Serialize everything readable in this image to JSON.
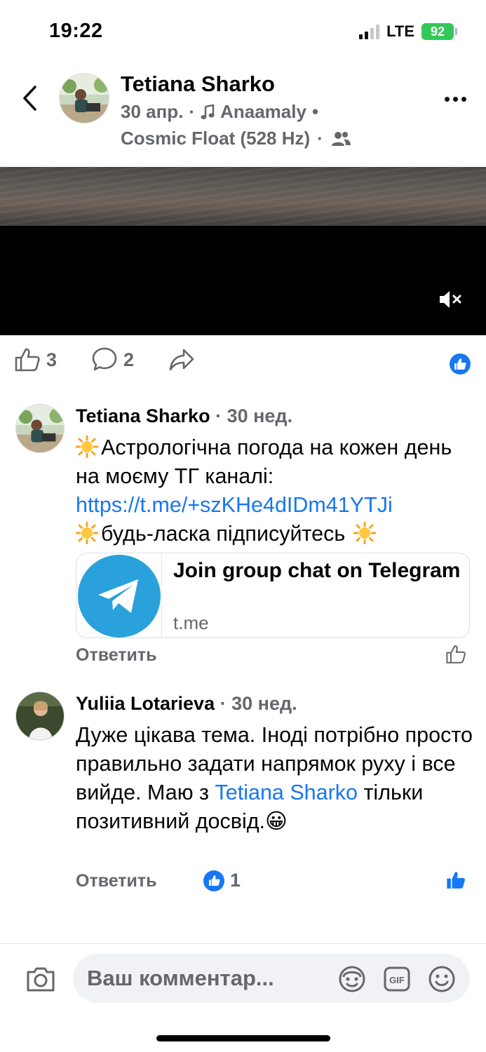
{
  "status_bar": {
    "time": "19:22",
    "network": "LTE",
    "battery": "92"
  },
  "header": {
    "author": "Tetiana Sharko",
    "date": "30 апр.",
    "music_artist": "Anaamaly",
    "music_track": "Cosmic Float (528 Hz)",
    "icons": [
      "back-icon",
      "music-note-icon",
      "friends-icon",
      "more-icon"
    ]
  },
  "actions": {
    "likes": "3",
    "comments": "2"
  },
  "comments": [
    {
      "author": "Tetiana Sharko",
      "time": "· 30 нед.",
      "text_part1": "Астрологічна погода  на кожен день на моєму ТГ каналі: ",
      "link": "https://t.me/+szKHe4dIDm41YTJi",
      "text_part2": "будь-ласка підписуйтесь",
      "card": {
        "title": "Join group chat on Telegram",
        "domain": "t.me"
      },
      "reply_label": "Ответить"
    },
    {
      "author": "Yuliia Lotarieva",
      "time": "· 30 нед.",
      "text_part1": "Дуже цікава тема. Іноді потрібно просто правильно задати напрямок руху і все вийде. Маю з ",
      "mention": "Tetiana Sharko",
      "text_part2": " тільки позитивний досвід.",
      "emoji": "😀",
      "reply_label": "Ответить",
      "reaction_count": "1"
    }
  ],
  "composer": {
    "placeholder": "Ваш комментар..."
  },
  "colors": {
    "accent": "#1877f2",
    "secondary_text": "#65676b",
    "telegram": "#2aa1da",
    "battery": "#34c759"
  }
}
